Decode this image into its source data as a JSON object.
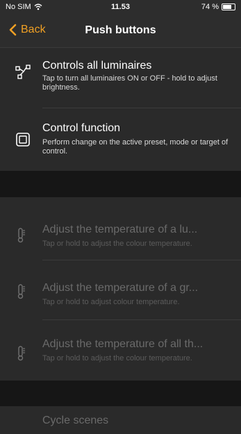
{
  "status_bar": {
    "carrier": "No SIM",
    "time": "11.53",
    "battery": "74 %"
  },
  "nav": {
    "back_label": "Back",
    "title": "Push buttons"
  },
  "rows": [
    {
      "title": "Controls all luminaires",
      "description": "Tap to turn all luminaires ON or OFF - hold to adjust brightness."
    },
    {
      "title": "Control function",
      "description": "Perform change on the active preset, mode or target of control."
    },
    {
      "title": "Adjust the temperature of a lu...",
      "description": "Tap or hold to adjust the colour temperature."
    },
    {
      "title": "Adjust the temperature of a gr...",
      "description": "Tap or hold to adjust colour temperature."
    },
    {
      "title": "Adjust the temperature of all th...",
      "description": "Tap or hold to adjust the colour temperature."
    },
    {
      "title": "Cycle scenes"
    }
  ],
  "colors": {
    "accent": "#f0a024",
    "background": "#1e1e1e",
    "row": "#2a2a2a",
    "disabled_text": "#6a6a6a"
  }
}
